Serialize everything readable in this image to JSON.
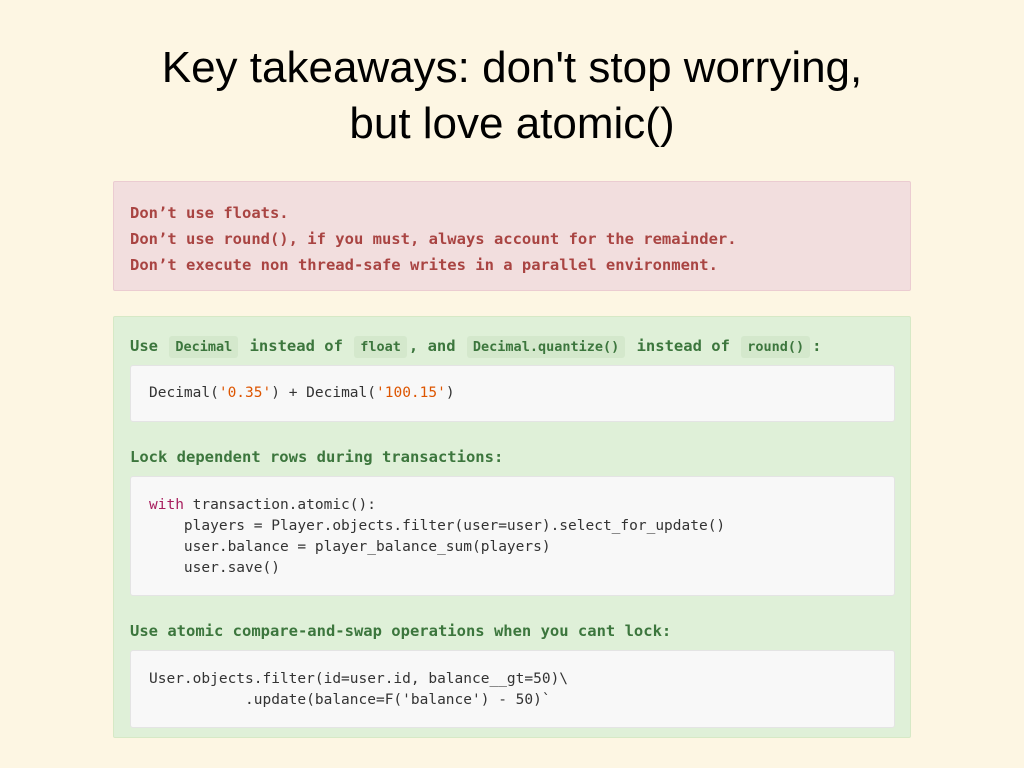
{
  "title": {
    "line1": "Key takeaways: don't stop worrying,",
    "line2": "but love atomic()"
  },
  "warnings": [
    "Don’t use floats.",
    "Don’t use round(), if you must, always account for the remainder.",
    "Don’t execute non thread-safe writes in a parallel environment."
  ],
  "tip1": {
    "use": "Use",
    "decimal": "Decimal",
    "instead_of_1": "instead of",
    "float": "float",
    "and": ", and",
    "quantize": "Decimal.quantize()",
    "instead_of_2": "instead of",
    "round": "round()",
    "colon": ":",
    "code": {
      "p1": "Decimal(",
      "s1": "'0.35'",
      "p2": ") + Decimal(",
      "s2": "'100.15'",
      "p3": ")"
    }
  },
  "tip2": {
    "heading": "Lock dependent rows during transactions:",
    "code": {
      "kw": "with",
      "line1_rest": " transaction.atomic():",
      "line2": "    players = Player.objects.filter(user=user).select_for_update()",
      "line3": "    user.balance = player_balance_sum(players)",
      "line4": "    user.save()"
    }
  },
  "tip3": {
    "heading": "Use atomic compare-and-swap operations when you cant lock:",
    "code": {
      "line1": "User.objects.filter(id=user.id, balance__gt=50)\\",
      "line2": "           .update(balance=F('balance') - 50)`"
    }
  }
}
